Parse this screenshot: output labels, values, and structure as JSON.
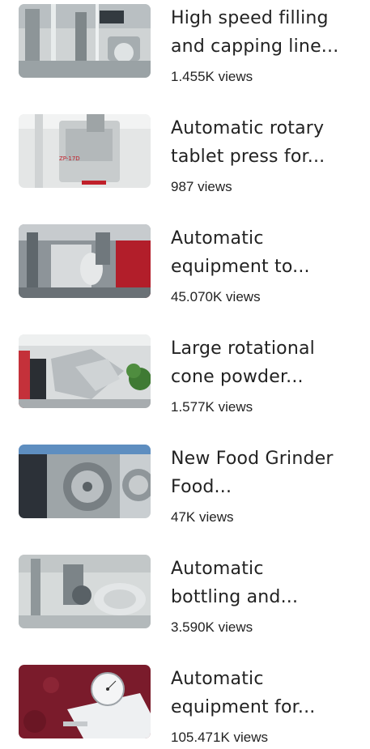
{
  "videos": [
    {
      "title_line1": "High speed filling",
      "title_line2": "and capping line...",
      "views": "1.455K views",
      "thumb_icon": "filling-line-thumbnail"
    },
    {
      "title_line1": "Automatic rotary",
      "title_line2": "tablet press for...",
      "views": "987 views",
      "thumb_icon": "tablet-press-thumbnail",
      "thumb_text": "ZP-17D"
    },
    {
      "title_line1": "Automatic",
      "title_line2": "equipment to...",
      "views": "45.070K views",
      "thumb_icon": "equipment-thumbnail"
    },
    {
      "title_line1": "Large rotational",
      "title_line2": "cone powder...",
      "views": "1.577K views",
      "thumb_icon": "cone-mixer-thumbnail"
    },
    {
      "title_line1": "New Food Grinder",
      "title_line2": "Food...",
      "views": "47K views",
      "thumb_icon": "food-grinder-thumbnail"
    },
    {
      "title_line1": "Automatic",
      "title_line2": "bottling and...",
      "views": "3.590K views",
      "thumb_icon": "bottling-line-thumbnail"
    },
    {
      "title_line1": "Automatic",
      "title_line2": "equipment for...",
      "views": "105.471K views",
      "thumb_icon": "dial-gauge-thumbnail"
    }
  ]
}
